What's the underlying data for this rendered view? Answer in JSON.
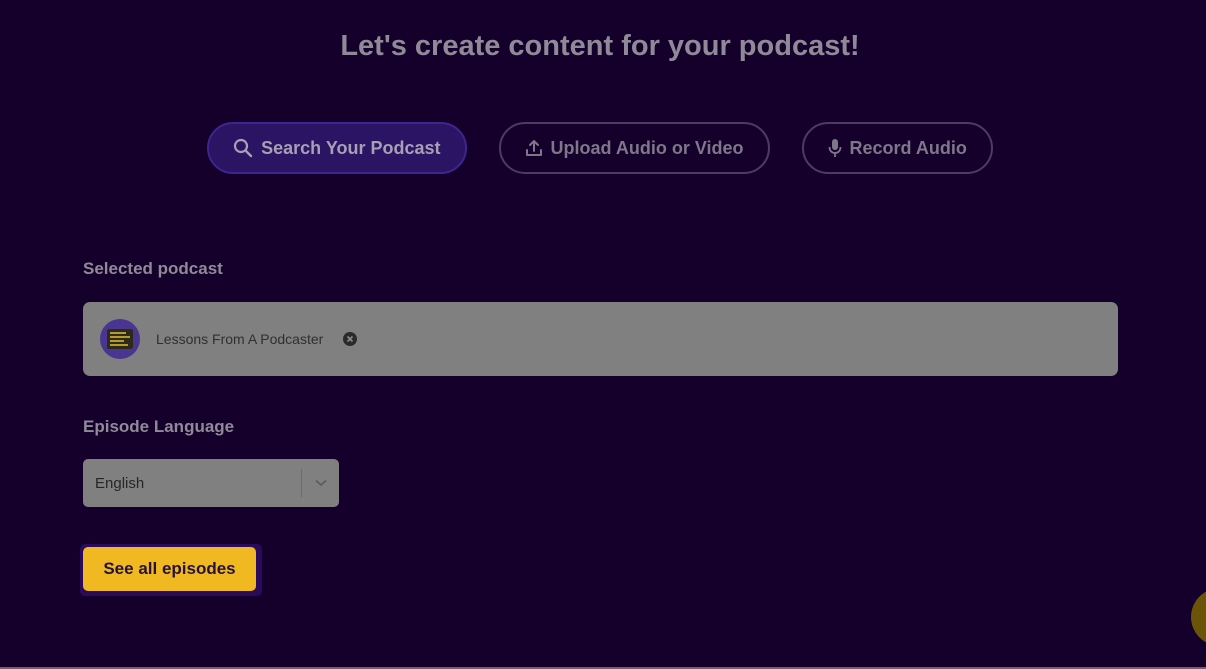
{
  "page": {
    "title": "Let's create content for your podcast!"
  },
  "source_tabs": [
    {
      "label": "Search Your Podcast",
      "icon": "search-icon",
      "active": true
    },
    {
      "label": "Upload Audio or Video",
      "icon": "upload-icon",
      "active": false
    },
    {
      "label": "Record Audio",
      "icon": "microphone-icon",
      "active": false
    }
  ],
  "selected_podcast": {
    "label": "Selected podcast",
    "name": "Lessons From A Podcaster"
  },
  "language": {
    "label": "Episode Language",
    "value": "English"
  },
  "actions": {
    "see_all_label": "See all episodes"
  },
  "colors": {
    "background": "#14002a",
    "accent": "#f0b922",
    "active_tab": "#2a1463"
  }
}
